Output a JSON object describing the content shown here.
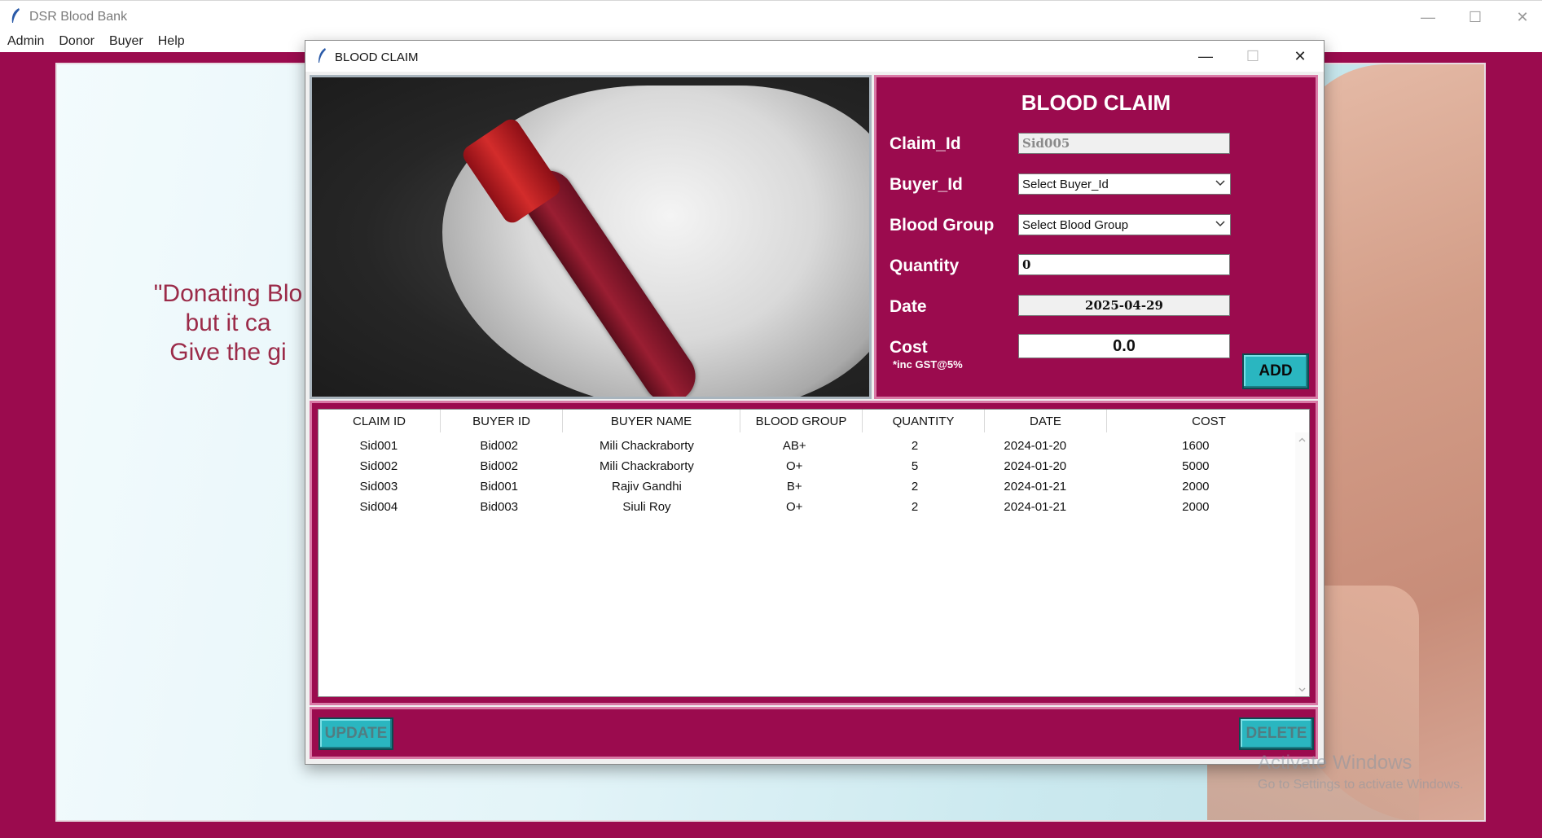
{
  "main_window": {
    "title": "DSR Blood Bank",
    "controls": [
      "—",
      "☐",
      "✕"
    ],
    "menu": [
      "Admin",
      "Donor",
      "Buyer",
      "Help"
    ]
  },
  "background": {
    "quote_lines": [
      "\"Donating Blo",
      "but it ca",
      "Give the gi"
    ],
    "watermark_line1": "Activate Windows",
    "watermark_line2": "Go to Settings to activate Windows."
  },
  "dialog": {
    "title": "BLOOD CLAIM",
    "controls": [
      "—",
      "☐",
      "✕"
    ]
  },
  "form": {
    "title": "BLOOD CLAIM",
    "claim_id_label": "Claim_Id",
    "claim_id_value": "Sid005",
    "buyer_id_label": "Buyer_Id",
    "buyer_id_selected": "Select Buyer_Id",
    "blood_group_label": "Blood Group",
    "blood_group_selected": "Select Blood Group",
    "quantity_label": "Quantity",
    "quantity_value": "0",
    "date_label": "Date",
    "date_value": "2025-04-29",
    "cost_label": "Cost",
    "cost_note": "*inc GST@5%",
    "cost_value": "0.0",
    "add_label": "ADD"
  },
  "table": {
    "columns": [
      "CLAIM ID",
      "BUYER ID",
      "BUYER NAME",
      "BLOOD GROUP",
      "QUANTITY",
      "DATE",
      "COST"
    ],
    "rows": [
      [
        "Sid001",
        "Bid002",
        "Mili Chackraborty",
        "AB+",
        "2",
        "2024-01-20",
        "1600"
      ],
      [
        "Sid002",
        "Bid002",
        "Mili Chackraborty",
        "O+",
        "5",
        "2024-01-20",
        "5000"
      ],
      [
        "Sid003",
        "Bid001",
        "Rajiv Gandhi",
        "B+",
        "2",
        "2024-01-21",
        "2000"
      ],
      [
        "Sid004",
        "Bid003",
        "Siuli Roy",
        "O+",
        "2",
        "2024-01-21",
        "2000"
      ]
    ]
  },
  "buttons": {
    "update_label": "UPDATE",
    "delete_label": "DELETE"
  },
  "colors": {
    "maroon": "#9b0b4e",
    "panel_border": "#d97aa6",
    "button_teal": "#2ab6c0"
  }
}
